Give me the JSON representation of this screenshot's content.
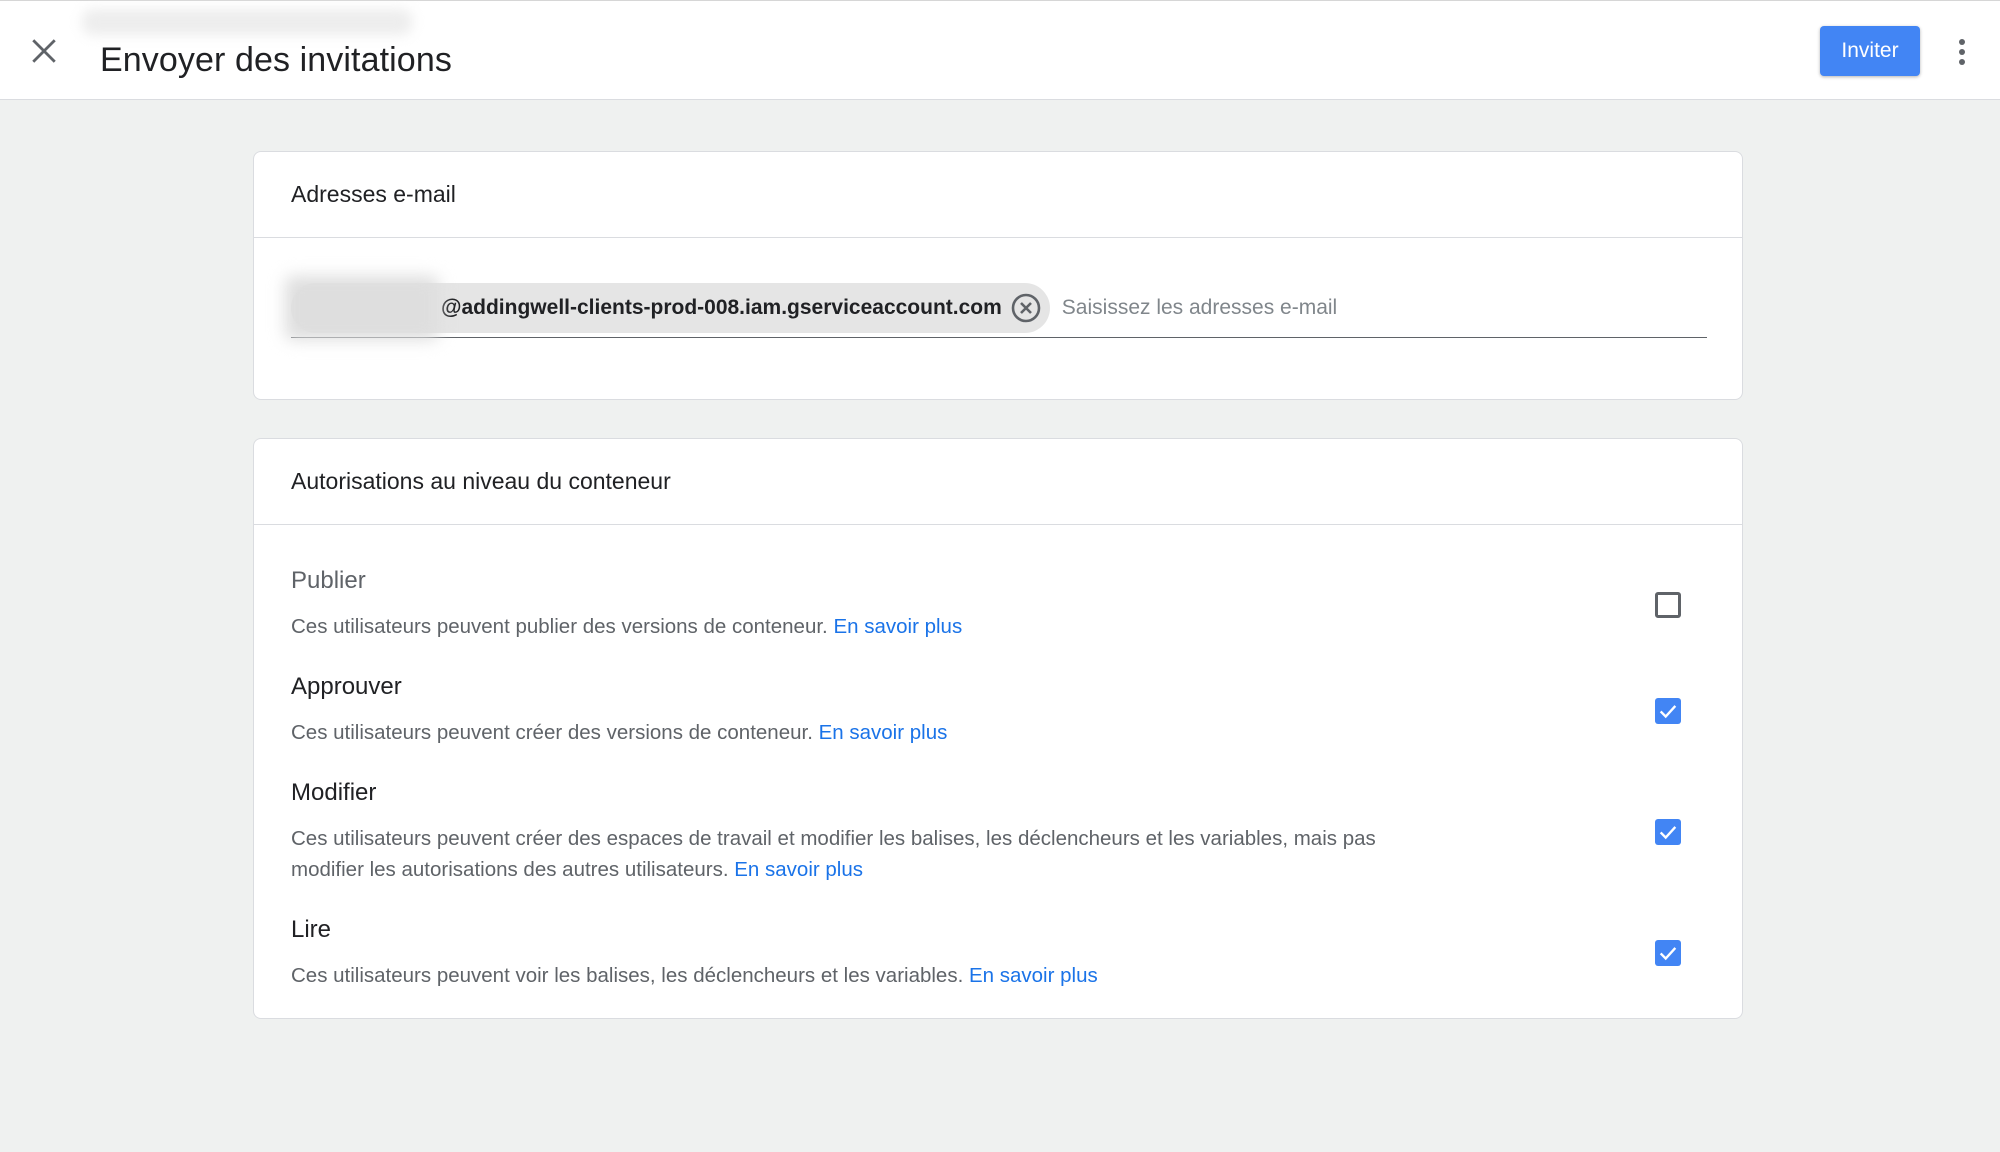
{
  "header": {
    "title": "Envoyer des invitations",
    "invite_label": "Inviter"
  },
  "email_section": {
    "title": "Adresses e-mail",
    "chip_email_visible": "@addingwell-clients-prod-008.iam.gserviceaccount.com",
    "input_placeholder": "Saisissez les adresses e-mail"
  },
  "permissions_section": {
    "title": "Autorisations au niveau du conteneur",
    "items": [
      {
        "title": "Publier",
        "description": "Ces utilisateurs peuvent publier des versions de conteneur.",
        "link": "En savoir plus",
        "checked": false
      },
      {
        "title": "Approuver",
        "description": "Ces utilisateurs peuvent créer des versions de conteneur.",
        "link": "En savoir plus",
        "checked": true
      },
      {
        "title": "Modifier",
        "description": "Ces utilisateurs peuvent créer des espaces de travail et modifier les balises, les déclencheurs et les variables, mais pas modifier les autorisations des autres utilisateurs.",
        "link": "En savoir plus",
        "checked": true
      },
      {
        "title": "Lire",
        "description": "Ces utilisateurs peuvent voir les balises, les déclencheurs et les variables.",
        "link": "En savoir plus",
        "checked": true
      }
    ]
  },
  "colors": {
    "accent": "#4285f4",
    "link": "#1a73e8",
    "background": "#eff1f0"
  },
  "icons": {
    "close": "close-icon",
    "more": "more-vert-icon",
    "chip_remove": "cancel-circle-icon",
    "check": "check-icon"
  }
}
